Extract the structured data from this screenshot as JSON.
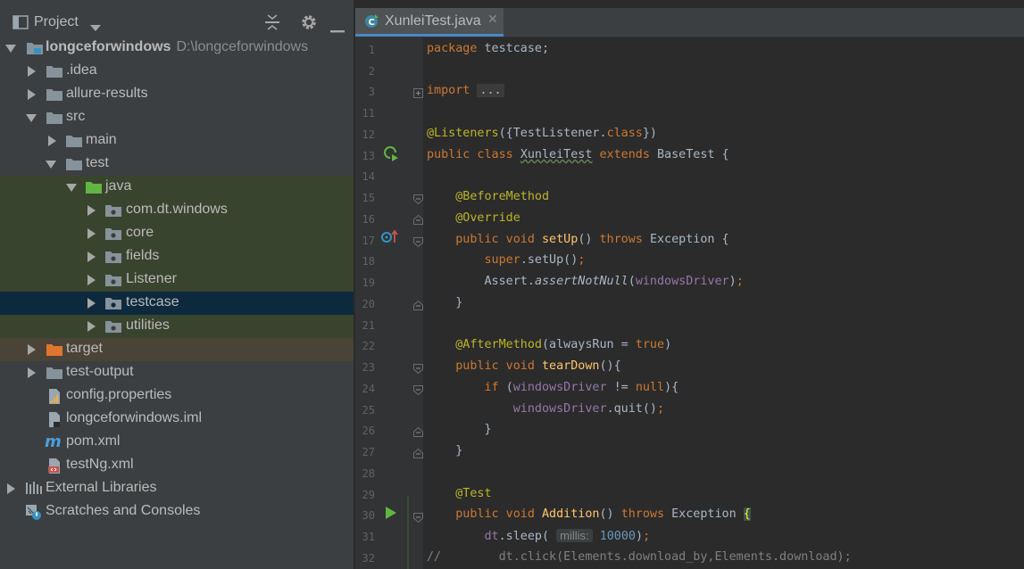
{
  "project_panel": {
    "title": "Project",
    "header_icons": [
      "chevron-down-icon",
      "collapse-all-icon",
      "gear-icon",
      "minimize-icon"
    ],
    "tree": [
      {
        "label": "longceforwindows",
        "path": "D:\\longceforwindows"
      },
      {
        "label": ".idea"
      },
      {
        "label": "allure-results"
      },
      {
        "label": "src"
      },
      {
        "label": "main"
      },
      {
        "label": "test"
      },
      {
        "label": "java"
      },
      {
        "label": "com.dt.windows"
      },
      {
        "label": "core"
      },
      {
        "label": "fields"
      },
      {
        "label": "Listener"
      },
      {
        "label": "testcase"
      },
      {
        "label": "utilities"
      },
      {
        "label": "target"
      },
      {
        "label": "test-output"
      },
      {
        "label": "config.properties"
      },
      {
        "label": "longceforwindows.iml"
      },
      {
        "label": "pom.xml"
      },
      {
        "label": "testNg.xml"
      },
      {
        "label": "External Libraries"
      },
      {
        "label": "Scratches and Consoles"
      }
    ]
  },
  "editor": {
    "tab": {
      "label": "XunleiTest.java"
    },
    "gutter_lines": [
      "1",
      "2",
      "3",
      "11",
      "12",
      "13",
      "14",
      "15",
      "16",
      "17",
      "18",
      "19",
      "20",
      "21",
      "22",
      "23",
      "24",
      "25",
      "26",
      "27",
      "28",
      "29",
      "30",
      "31",
      "32"
    ],
    "code": {
      "l1_kw": "package",
      "l1_rest": " testcase;",
      "l3_kw": "import",
      "l3_fold": "...",
      "l12_an": "@Listeners",
      "l12_a": "({TestListener.",
      "l12_kw": "class",
      "l12_b": "})",
      "l13_kw1": "public class ",
      "l13_name": "XunleiTest",
      "l13_kw2": " extends ",
      "l13_rest": "BaseTest {",
      "l15_an": "@BeforeMethod",
      "l16_an": "@Override",
      "l17_kw": "public void ",
      "l17_fn": "setUp",
      "l17_a": "() ",
      "l17_kw2": "throws ",
      "l17_b": "Exception {",
      "l18_kw": "super",
      "l18_a": ".setUp()",
      "l18_b": ";",
      "l19_a": "Assert.",
      "l19_it": "assertNotNull",
      "l19_b": "(",
      "l19_fld": "windowsDriver",
      "l19_c": ")",
      "l19_d": ";",
      "l20": "}",
      "l22_an": "@AfterMethod",
      "l22_a": "(alwaysRun = ",
      "l22_kw": "true",
      "l22_b": ")",
      "l23_kw": "public void ",
      "l23_fn": "tearDown",
      "l23_a": "(){",
      "l24_kw": "if ",
      "l24_a": "(",
      "l24_fld": "windowsDriver",
      "l24_b": " != ",
      "l24_kw2": "null",
      "l24_c": "){",
      "l25_fld": "windowsDriver",
      "l25_a": ".quit()",
      "l25_b": ";",
      "l26": "}",
      "l27": "}",
      "l29_an": "@Test",
      "l30_kw": "public void ",
      "l30_fn": "Addition",
      "l30_a": "() ",
      "l30_kw2": "throws ",
      "l30_b": "Exception ",
      "l30_brace": "{",
      "l31_fld": "dt",
      "l31_a": ".sleep( ",
      "l31_hint": "millis:",
      "l31_num": "10000",
      "l31_b": ")",
      "l31_c": ";",
      "l32_cm": "//        dt.click(Elements.download_by,Elements.download);"
    }
  }
}
